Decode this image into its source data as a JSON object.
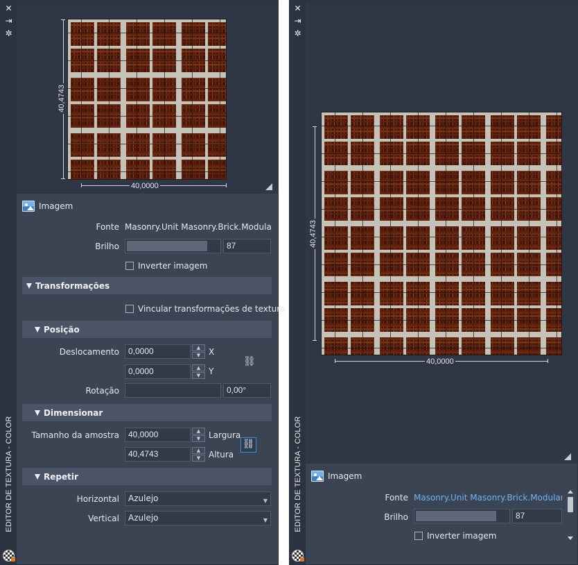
{
  "palette": {
    "panel_bg": "#3b4453",
    "strip_bg": "#2b3240",
    "preview_bg": "#2f3747",
    "group_bg": "#4a5466",
    "link_text": "#6fb3f5",
    "accent_border": "#3c8fd8"
  },
  "left_panel": {
    "title": "EDITOR DE TEXTURA - COLOR",
    "strip_icons": [
      "close-icon",
      "pin-icon",
      "settings-icon"
    ],
    "preview": {
      "height_dim": "40,4743",
      "width_dim": "40,0000"
    },
    "image_section": {
      "title": "Imagem",
      "source_label": "Fonte",
      "source_value": "Masonry.Unit Masonry.Brick.Modular.Ba",
      "brightness_label": "Brilho",
      "brightness_value": "87",
      "brightness_level": 0.87,
      "invert_label": "Inverter imagem",
      "invert_checked": false
    },
    "transforms": {
      "title": "Transformações",
      "link_label": "Vincular transformações de textura",
      "link_checked": false,
      "position": {
        "title": "Posição",
        "offset_label": "Deslocamento",
        "offset_x": "0,0000",
        "x_label": "X",
        "offset_y": "0,0000",
        "y_label": "Y",
        "rotation_label": "Rotação",
        "rotation_value": "0,00°"
      },
      "scale": {
        "title": "Dimensionar",
        "sample_size_label": "Tamanho da amostra",
        "width_value": "40,0000",
        "width_label": "Largura",
        "height_value": "40,4743",
        "height_label": "Altura"
      },
      "repeat": {
        "title": "Repetir",
        "horizontal_label": "Horizontal",
        "horizontal_value": "Azulejo",
        "vertical_label": "Vertical",
        "vertical_value": "Azulejo"
      }
    }
  },
  "right_panel": {
    "title": "EDITOR DE TEXTURA - COLOR",
    "strip_icons": [
      "close-icon",
      "pin-icon",
      "settings-icon"
    ],
    "preview": {
      "height_dim": "40,4743",
      "width_dim": "40,0000"
    },
    "image_section": {
      "title": "Imagem",
      "source_label": "Fonte",
      "source_value": "Masonry.Unit Masonry.Brick.Modular.Bas",
      "brightness_label": "Brilho",
      "brightness_value": "87",
      "brightness_level": 0.87,
      "invert_label": "Inverter imagem",
      "invert_checked": false
    }
  }
}
